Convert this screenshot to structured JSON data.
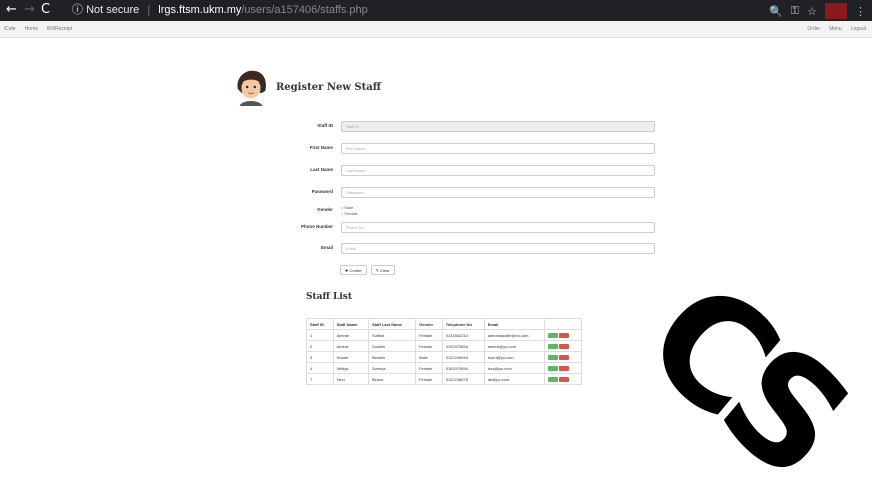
{
  "browser": {
    "not_secure": "Not secure",
    "host": "lrgs.ftsm.ukm.my",
    "path": "/users/a157406/staffs.php"
  },
  "appnav": {
    "brand": "iCafe",
    "links": [
      "Home",
      "Bill/Receipt"
    ],
    "right_links": [
      "Order",
      "Menu",
      "Logout"
    ]
  },
  "header": {
    "title": "Register New Staff"
  },
  "form": {
    "staff_id": {
      "label": "Staff ID",
      "placeholder": "Staff ID"
    },
    "first_name": {
      "label": "First Name",
      "placeholder": "First Name"
    },
    "last_name": {
      "label": "Last Name",
      "placeholder": "Last Name"
    },
    "password": {
      "label": "Password",
      "placeholder": "Password"
    },
    "gender": {
      "label": "Gender",
      "options": [
        "Male",
        "Female"
      ]
    },
    "phone": {
      "label": "Phone Number",
      "placeholder": "Phone No"
    },
    "email": {
      "label": "Email",
      "placeholder": "Email"
    },
    "create_label": "Create",
    "clear_label": "Clear"
  },
  "staff_list": {
    "title": "Staff List",
    "columns": [
      "Staff ID",
      "Staff Name",
      "Staff Last Name",
      "Gender",
      "Telephone No",
      "Email",
      ""
    ],
    "rows": [
      [
        "1",
        "Aimran",
        "Sufilea",
        "Female",
        "0131662210",
        "aimranasufile@xo.com"
      ],
      [
        "2",
        "Amera",
        "Suzelin",
        "Female",
        "0193379654",
        "amera@yo.com"
      ],
      [
        "3",
        "Hunrie",
        "Benelis",
        "Male",
        "0122246054",
        "hunri@yo.com"
      ],
      [
        "4",
        "Wellya",
        "Sunnya",
        "Female",
        "0193379654",
        "lscs@po.com"
      ],
      [
        "7",
        "Heci",
        "Benos",
        "Female",
        "0122248678",
        "ab@po.com"
      ]
    ]
  },
  "watermark": "CS"
}
